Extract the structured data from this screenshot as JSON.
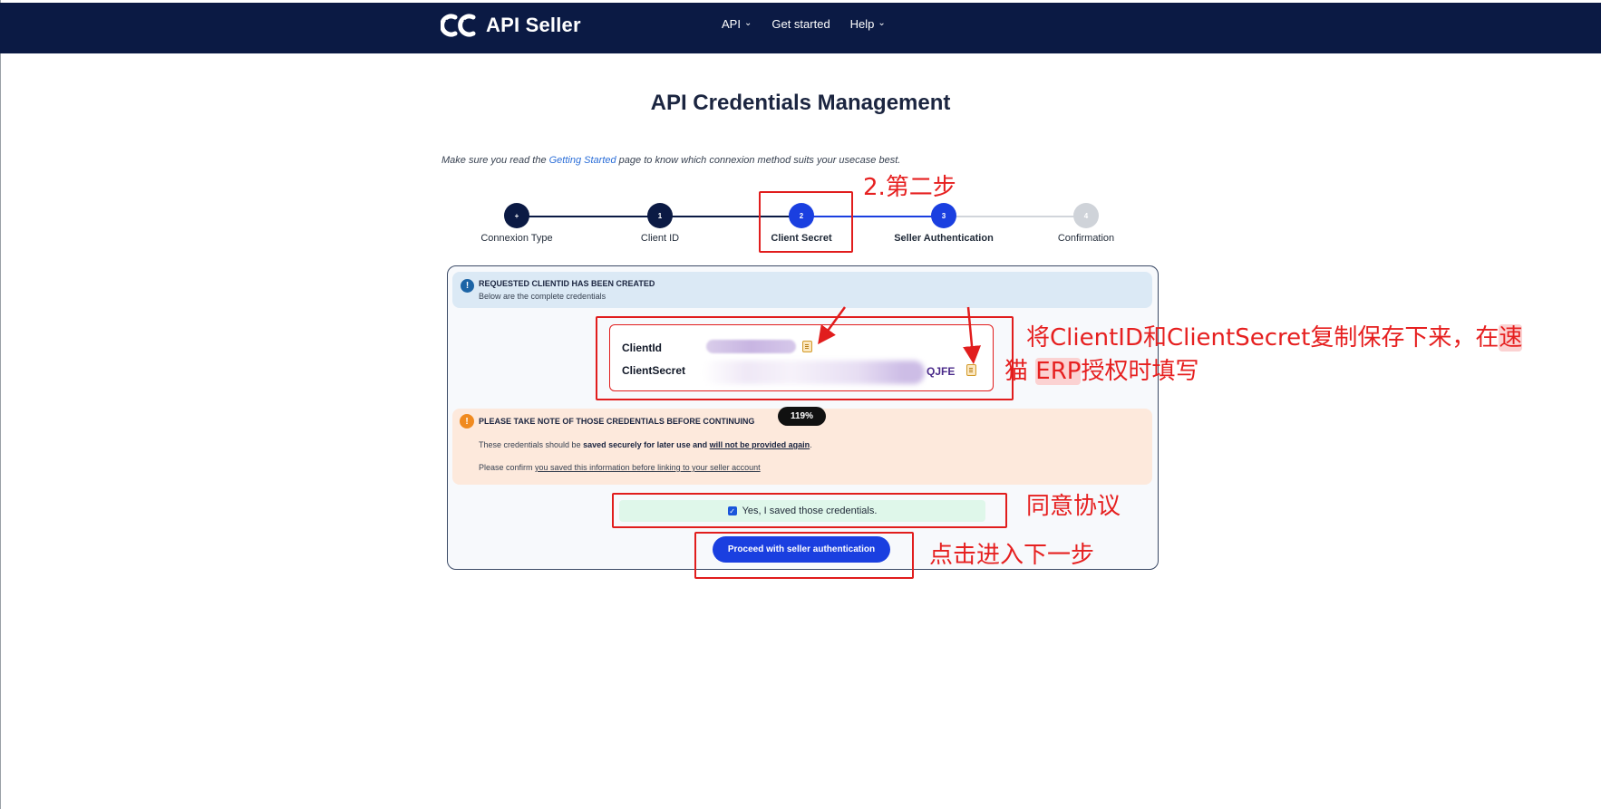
{
  "header": {
    "logo_text": "API Seller",
    "nav": [
      {
        "label": "API",
        "has_dropdown": true
      },
      {
        "label": "Get started",
        "has_dropdown": false
      },
      {
        "label": "Help",
        "has_dropdown": true
      }
    ]
  },
  "page": {
    "title": "API Credentials Management",
    "intro_before": "Make sure you read the ",
    "intro_link": "Getting Started",
    "intro_after": " page to know which connexion method suits your usecase best."
  },
  "stepper": {
    "steps": [
      {
        "marker": "+",
        "label": "Connexion Type",
        "state": "done"
      },
      {
        "marker": "1",
        "label": "Client ID",
        "state": "done"
      },
      {
        "marker": "2",
        "label": "Client Secret",
        "state": "current"
      },
      {
        "marker": "3",
        "label": "Seller Authentication",
        "state": "next"
      },
      {
        "marker": "4",
        "label": "Confirmation",
        "state": "upcoming"
      }
    ]
  },
  "info": {
    "icon": "info-icon",
    "title": "REQUESTED CLIENTID HAS BEEN CREATED",
    "subtitle": "Below are the complete credentials"
  },
  "credentials": {
    "client_id_label": "ClientId",
    "client_secret_label": "ClientSecret",
    "client_secret_visible_tail": "QJFE"
  },
  "zoom_badge": "119%",
  "warning": {
    "icon": "warning-icon",
    "title": "PLEASE TAKE NOTE OF THOSE CREDENTIALS BEFORE CONTINUING",
    "line1_pre": "These credentials should be ",
    "line1_bold1": "saved securely for later use and",
    "line1_mid": " ",
    "line1_bold2": "will not be provided again",
    "line1_post": ".",
    "line2_pre": "Please confirm ",
    "line2_link": "you saved this information before linking to your seller account"
  },
  "confirm": {
    "checked": true,
    "label": "Yes, I saved those credentials."
  },
  "proceed_button": "Proceed with seller authentication",
  "annotations": {
    "step2": "2.第二步",
    "copy_line1_a": "将ClientID和ClientSecret复制保存下来，在",
    "copy_line1_hl": "速",
    "copy_line2_a": "猫 ",
    "copy_line2_hl": "ERP",
    "copy_line2_b": "授权时填写",
    "agree": "同意协议",
    "next": "点击进入下一步"
  },
  "colors": {
    "header_bg": "#0b1a44",
    "step_done": "#0b1a44",
    "step_active": "#1a3fe0",
    "step_upcoming": "#cfd3d9",
    "annotation_red": "#e11d1d"
  }
}
